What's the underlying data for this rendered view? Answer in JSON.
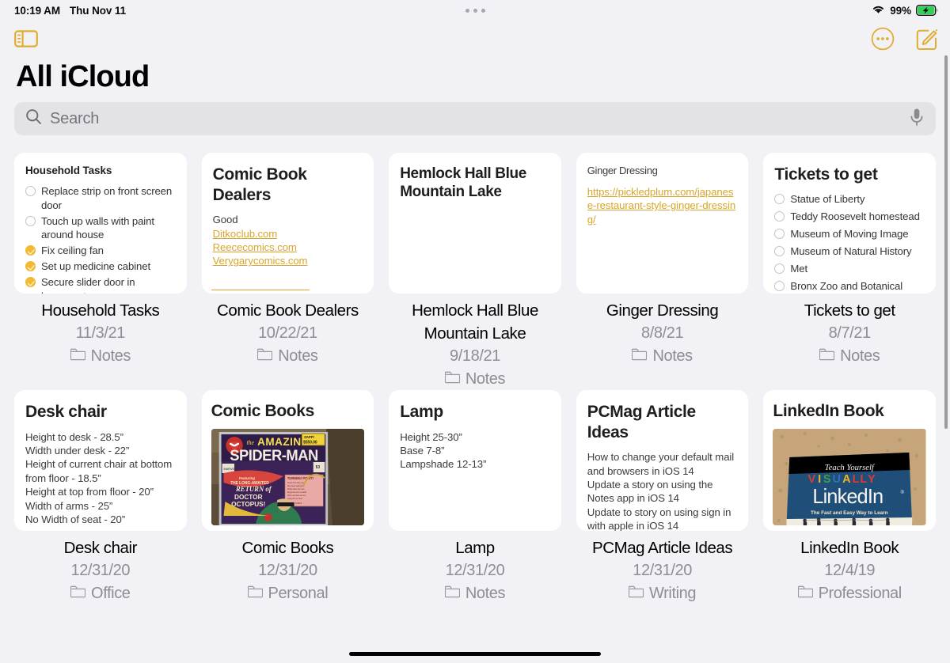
{
  "status_bar": {
    "time": "10:19 AM",
    "date": "Thu Nov 11",
    "battery_percent": "99%",
    "wifi_icon": "wifi-icon",
    "battery_icon": "battery-charging-icon",
    "multitask_icon": "multitasking-dots-icon"
  },
  "nav": {
    "sidebar_toggle_icon": "sidebar-toggle-icon",
    "more_icon": "more-ellipsis-icon",
    "compose_icon": "compose-note-icon",
    "accent_color": "#e0ae2e"
  },
  "header": {
    "title": "All iCloud"
  },
  "search": {
    "placeholder": "Search",
    "value": "",
    "search_icon": "search-icon",
    "mic_icon": "microphone-icon"
  },
  "notes": [
    {
      "title": "Household Tasks",
      "title_style": "small",
      "date": "11/3/21",
      "folder": "Notes",
      "preview_type": "checklist",
      "checklist": [
        {
          "text": "Replace strip on front screen door",
          "done": false
        },
        {
          "text": "Touch up walls with paint around house",
          "done": false
        },
        {
          "text": "Fix ceiling fan",
          "done": true
        },
        {
          "text": "Set up medicine cabinet",
          "done": true
        },
        {
          "text": "Secure slider door in basement",
          "done": true
        }
      ]
    },
    {
      "title": "Comic Book Dealers",
      "title_style": "big",
      "date": "10/22/21",
      "folder": "Notes",
      "preview_type": "links",
      "lead": "Good",
      "links": [
        "Ditkoclub.com",
        "Reececomics.com",
        "Verygarycomics.com"
      ]
    },
    {
      "title": "Hemlock Hall Blue Mountain Lake",
      "title_style": "mid",
      "date": "9/18/21",
      "folder": "Notes",
      "preview_type": "empty"
    },
    {
      "title": "Ginger Dressing",
      "title_style": "plain",
      "date": "8/8/21",
      "folder": "Notes",
      "preview_type": "links",
      "links": [
        "https://pickledplum.com/japanese-restaurant-style-ginger-dressing/"
      ]
    },
    {
      "title": "Tickets to get",
      "title_style": "big",
      "date": "8/7/21",
      "folder": "Notes",
      "preview_type": "checklist",
      "checklist": [
        {
          "text": "Statue of Liberty",
          "done": false
        },
        {
          "text": "Teddy Roosevelt homestead",
          "done": false
        },
        {
          "text": "Museum of Moving Image",
          "done": false
        },
        {
          "text": "Museum of Natural History",
          "done": false
        },
        {
          "text": "Met",
          "done": false
        },
        {
          "text": "Bronx Zoo and Botanical",
          "done": false
        }
      ]
    },
    {
      "title": "Desk chair",
      "title_style": "big",
      "date": "12/31/20",
      "folder": "Office",
      "preview_type": "text",
      "lines": [
        "Height to desk - 28.5”",
        "Width under desk - 22”",
        "Height of current chair at bottom from floor - 18.5”",
        "Height at top from floor - 20”",
        "Width of arms - 25”",
        "No Width of seat - 20”"
      ]
    },
    {
      "title": "Comic Books",
      "title_style": "big",
      "date": "12/31/20",
      "folder": "Personal",
      "preview_type": "image",
      "image": "comic-book-spiderman-cover-photo",
      "image_text": {
        "the": "the",
        "amazing": "AMAZING",
        "spiderman": "SPIDER-MAN",
        "price_tag": "ZAPP!",
        "price": "$550.00",
        "featuring": "Featuring",
        "long_awaited": "THE LONG-AWAITED",
        "return_of": "RETURN of",
        "doctor": "DOCTOR",
        "octopus": "OCTOPUS!",
        "turning_point": "TURNING POINT!"
      }
    },
    {
      "title": "Lamp",
      "title_style": "big",
      "date": "12/31/20",
      "folder": "Notes",
      "preview_type": "text",
      "lines": [
        "Height 25-30”",
        "Base 7-8”",
        "Lampshade 12-13”"
      ]
    },
    {
      "title": "PCMag Article Ideas",
      "title_style": "big",
      "date": "12/31/20",
      "folder": "Writing",
      "preview_type": "text",
      "lines": [
        "How to change your default mail and browsers in iOS 14",
        "Update a story on using the Notes app in iOS 14",
        "Update to story on using sign in with apple in iOS 14"
      ]
    },
    {
      "title": "LinkedIn Book",
      "title_style": "big",
      "date": "12/4/19",
      "folder": "Professional",
      "preview_type": "image",
      "image": "linkedin-book-cover-photo",
      "image_text": {
        "teach_yourself": "Teach Yourself",
        "visually": "VISUALLY",
        "linkedin": "LinkedIn",
        "tagline": "The Fast and Easy Way to Learn"
      }
    }
  ]
}
